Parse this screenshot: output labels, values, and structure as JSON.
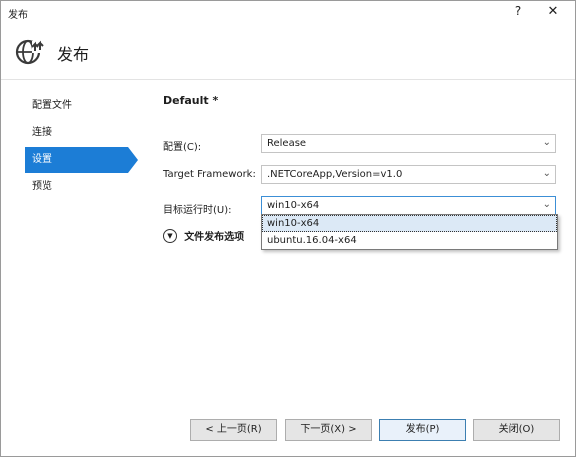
{
  "window": {
    "title": "发布",
    "help": "?",
    "close": "✕"
  },
  "header": {
    "title": "发布",
    "icon": "globe-publish-icon"
  },
  "nav": {
    "items": [
      {
        "label": "配置文件"
      },
      {
        "label": "连接"
      },
      {
        "label": "设置"
      },
      {
        "label": "预览"
      }
    ],
    "active_index": 2
  },
  "content": {
    "title": "Default *",
    "configuration": {
      "label": "配置(C):",
      "value": "Release"
    },
    "target_framework": {
      "label": "Target Framework:",
      "value": ".NETCoreApp,Version=v1.0"
    },
    "target_runtime": {
      "label": "目标运行时(U):",
      "value": "win10-x64",
      "options": [
        "win10-x64",
        "ubuntu.16.04-x64"
      ],
      "selected_index": 0
    },
    "file_publish_options": "文件发布选项"
  },
  "buttons": {
    "prev": "< 上一页(R)",
    "next": "下一页(X) >",
    "publish": "发布(P)",
    "close": "关闭(O)"
  },
  "colors": {
    "accent": "#1c7dd6"
  }
}
